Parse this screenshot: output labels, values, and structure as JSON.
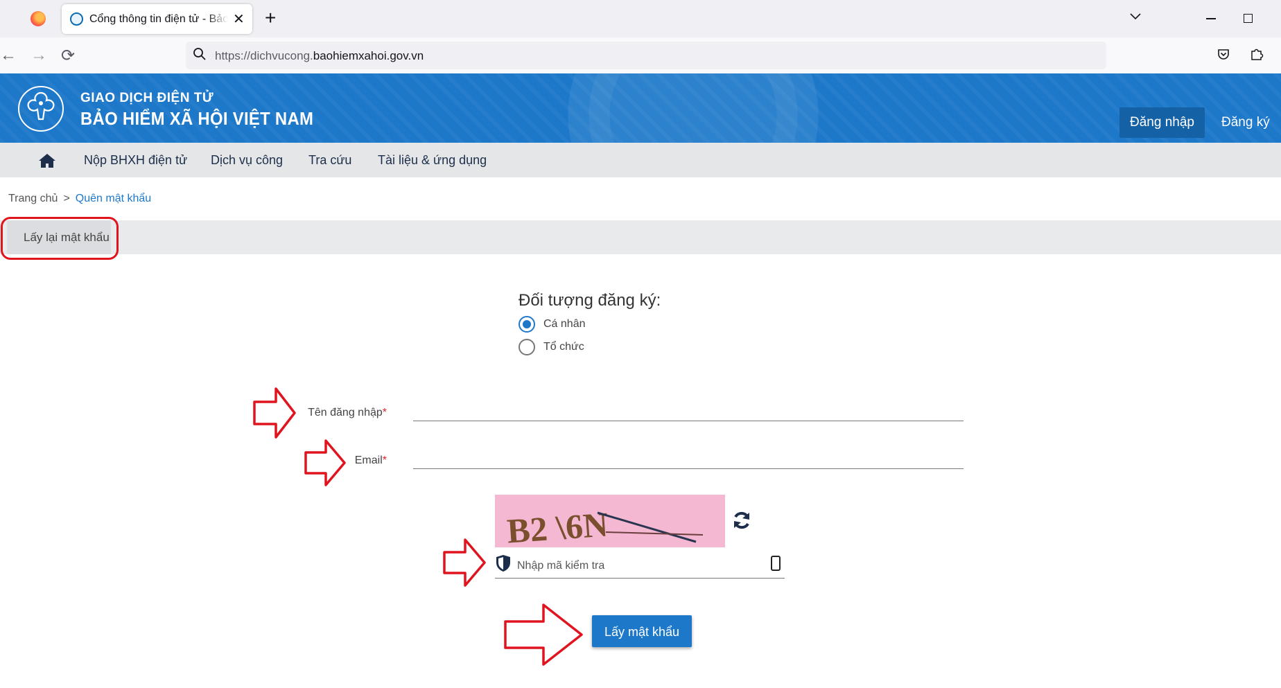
{
  "browser": {
    "tab_title": "Cổng thông tin điện tử - Bảo hiểm xã hội Việt Nam",
    "tab_close": "✕",
    "new_tab": "+",
    "tab_list": "⌄",
    "back": "←",
    "forward": "→",
    "reload": "⟳",
    "url_prefix": "https://dichvucong.",
    "url_domain": "baohiemxahoi.gov.vn"
  },
  "header": {
    "line1": "GIAO DỊCH ĐIỆN TỬ",
    "line2": "BẢO HIỂM XÃ HỘI VIỆT NAM",
    "login": "Đăng nhập",
    "register": "Đăng ký"
  },
  "menu": {
    "items": [
      "Nộp BHXH điện tử",
      "Dịch vụ công",
      "Tra cứu",
      "Tài liệu & ứng dụng"
    ]
  },
  "breadcrumb": {
    "home": "Trang chủ",
    "separator": ">",
    "current": "Quên mật khẩu"
  },
  "page": {
    "title": "Lấy lại mật khẩu"
  },
  "form": {
    "subject_label": "Đối tượng đăng ký:",
    "options": [
      {
        "label": "Cá nhân",
        "selected": true
      },
      {
        "label": "Tổ chức",
        "selected": false
      }
    ],
    "username_label": "Tên đăng nhập",
    "email_label": "Email",
    "required_mark": "*",
    "captcha_text": "B2 \\6N",
    "captcha_placeholder": "Nhập mã kiểm tra",
    "submit": "Lấy mật khẩu"
  },
  "colors": {
    "brand_blue": "#1d78c9",
    "annotation_red": "#e0141e"
  }
}
